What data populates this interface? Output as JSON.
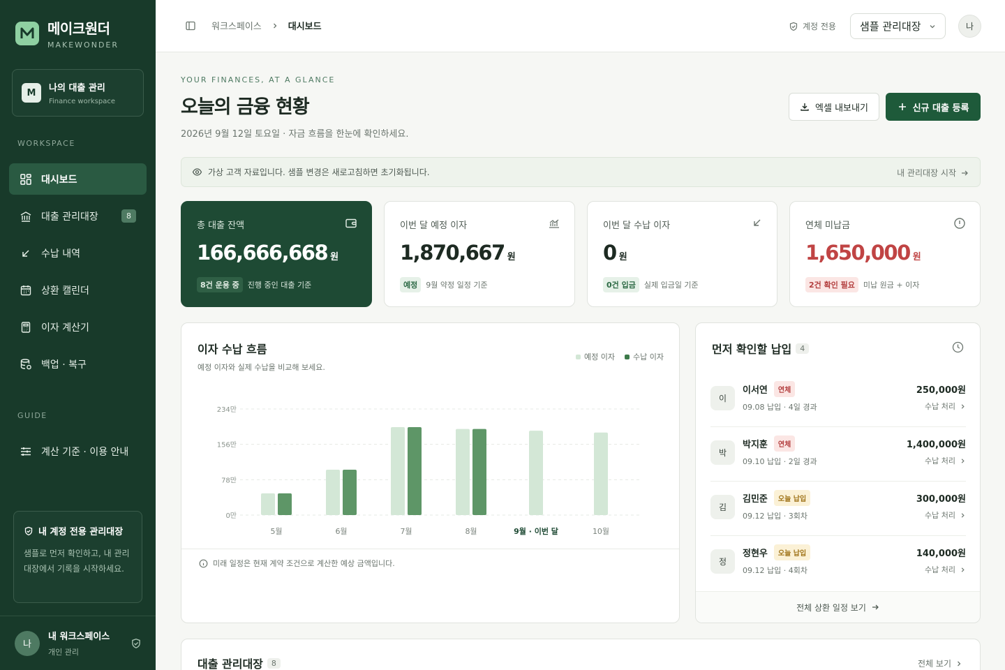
{
  "brand": {
    "name": "메이크원더",
    "sub": "MAKEWONDER",
    "logo": "M"
  },
  "workspace": {
    "avatar": "M",
    "name": "나의 대출 관리",
    "sub": "Finance workspace"
  },
  "nav": {
    "section_workspace": "WORKSPACE",
    "items": [
      {
        "label": "대시보드",
        "icon": "dashboard-icon",
        "active": true
      },
      {
        "label": "대출 관리대장",
        "icon": "bank-icon",
        "badge": "8"
      },
      {
        "label": "수납 내역",
        "icon": "arrow-down-left-icon"
      },
      {
        "label": "상환 캘린더",
        "icon": "calendar-icon"
      },
      {
        "label": "이자 계산기",
        "icon": "calculator-icon"
      },
      {
        "label": "백업 · 복구",
        "icon": "database-icon"
      }
    ],
    "section_guide": "GUIDE",
    "guide_item": {
      "label": "계산 기준 · 이용 안내",
      "icon": "sliders-icon"
    }
  },
  "promo": {
    "title": "내 계정 전용 관리대장",
    "body": "샘플로 먼저 확인하고, 내 관리대장에서 기록을 시작하세요."
  },
  "user": {
    "avatar": "나",
    "name": "내 워크스페이스",
    "sub": "개인 관리"
  },
  "topbar": {
    "crumb_root": "워크스페이스",
    "crumb_current": "대시보드",
    "account_label": "계정 전용",
    "select_value": "샘플 관리대장",
    "avatar": "나"
  },
  "header": {
    "eyebrow": "YOUR FINANCES, AT A GLANCE",
    "title": "오늘의 금융 현황",
    "subtitle": "2026년 9월 12일 토요일 · 자금 흐름을 한눈에 확인하세요.",
    "export_label": "엑셀 내보내기",
    "new_label": "신규 대출 등록"
  },
  "notice": {
    "text": "가상 고객 자료입니다. 샘플 변경은 새로고침하면 초기화됩니다.",
    "link": "내 관리대장 시작"
  },
  "kpis": [
    {
      "label": "총 대출 잔액",
      "value": "166,666,668",
      "unit": "원",
      "chip": "8건 운용 중",
      "note": "진행 중인 대출 기준",
      "icon": "wallet-icon"
    },
    {
      "label": "이번 달 예정 이자",
      "value": "1,870,667",
      "unit": "원",
      "chip": "예정",
      "note": "9월 약정 일정 기준",
      "icon": "trend-chart-icon"
    },
    {
      "label": "이번 달 수납 이자",
      "value": "0",
      "unit": "원",
      "chip": "0건 입금",
      "note": "실제 입금일 기준",
      "icon": "arrow-down-left-icon"
    },
    {
      "label": "연체 미납금",
      "value": "1,650,000",
      "unit": "원",
      "chip": "2건 확인 필요",
      "note": "미납 원금 + 이자",
      "icon": "alert-circle-icon"
    }
  ],
  "colors": {
    "planned": "#d3e7d6",
    "received": "#5e9667",
    "accent": "#1e5a3a",
    "danger": "#c04444"
  },
  "chart": {
    "title": "이자 수납 흐름",
    "subtitle": "예정 이자와 실제 수납을 비교해 보세요.",
    "footnote": "미래 일정은 현재 계약 조건으로 계산한 예상 금액입니다."
  },
  "chart_data": {
    "type": "bar",
    "categories": [
      "5월",
      "6월",
      "7월",
      "8월",
      "9월 · 이번 달",
      "10월"
    ],
    "highlight_category": "9월 · 이번 달",
    "series": [
      {
        "name": "예정 이자",
        "values": [
          48,
          100,
          194,
          190,
          186,
          182
        ]
      },
      {
        "name": "수납 이자",
        "values": [
          48,
          100,
          194,
          190,
          null,
          null
        ]
      }
    ],
    "yticks": [
      "0만",
      "78만",
      "156만",
      "234만"
    ],
    "ytick_values": [
      0,
      78,
      156,
      234
    ],
    "ylim": [
      0,
      234
    ],
    "grid": true,
    "legend": "top-right"
  },
  "due": {
    "title": "먼저 확인할 납입",
    "count": "4",
    "items": [
      {
        "avatar": "이",
        "name": "이서연",
        "tag": "연체",
        "tag_type": "over",
        "meta": "09.08 납입 · 4일 경과",
        "amount": "250,000원",
        "action": "수납 처리"
      },
      {
        "avatar": "박",
        "name": "박지훈",
        "tag": "연체",
        "tag_type": "over",
        "meta": "09.10 납입 · 2일 경과",
        "amount": "1,400,000원",
        "action": "수납 처리"
      },
      {
        "avatar": "김",
        "name": "김민준",
        "tag": "오늘 납입",
        "tag_type": "today",
        "meta": "09.12 납입 · 3회차",
        "amount": "300,000원",
        "action": "수납 처리"
      },
      {
        "avatar": "정",
        "name": "정현우",
        "tag": "오늘 납입",
        "tag_type": "today",
        "meta": "09.12 납입 · 4회차",
        "amount": "140,000원",
        "action": "수납 처리"
      }
    ],
    "footer": "전체 상환 일정 보기"
  },
  "ledger": {
    "title": "대출 관리대장",
    "count": "8",
    "link": "전체 보기"
  }
}
